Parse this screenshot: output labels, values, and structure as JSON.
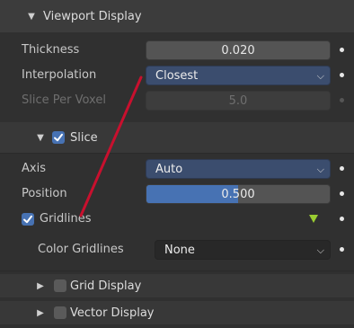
{
  "viewport_display": {
    "title": "Viewport Display",
    "thickness": {
      "label": "Thickness",
      "value": "0.020"
    },
    "interpolation": {
      "label": "Interpolation",
      "value": "Closest"
    },
    "slice_per_voxel": {
      "label": "Slice Per Voxel",
      "value": "5.0"
    },
    "slice": {
      "title": "Slice",
      "checked": true,
      "axis": {
        "label": "Axis",
        "value": "Auto"
      },
      "position": {
        "label": "Position",
        "value": "0.500",
        "fraction": 0.5
      },
      "gridlines": {
        "label": "Gridlines",
        "checked": true
      },
      "color_gridlines": {
        "label": "Color Gridlines",
        "value": "None"
      }
    },
    "grid_display": {
      "title": "Grid Display",
      "checked": false
    },
    "vector_display": {
      "title": "Vector Display",
      "checked": false
    }
  },
  "colors": {
    "accent": "#4772b3",
    "annotation": "#c8102e",
    "keyframe_marker": "#9acd32"
  }
}
